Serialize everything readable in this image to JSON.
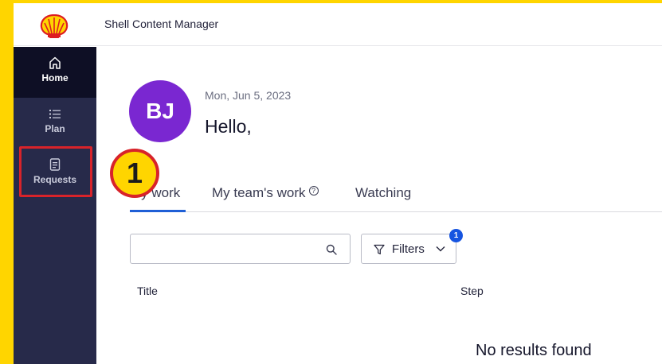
{
  "app": {
    "title": "Shell Content Manager",
    "logo_icon": "shell-logo-icon",
    "colors": {
      "frame": "#FFD500",
      "sidebar": "#272A4A",
      "sidebar_active": "#0E0F25",
      "accent": "#1F5FD6",
      "avatar": "#7A27D1",
      "highlight": "#D8232A"
    }
  },
  "sidebar": {
    "items": [
      {
        "label": "Home",
        "icon": "home-icon",
        "active": true
      },
      {
        "label": "Plan",
        "icon": "list-icon",
        "active": false
      },
      {
        "label": "Requests",
        "icon": "document-icon",
        "active": false
      }
    ]
  },
  "annotation": {
    "step_number": "1"
  },
  "user": {
    "initials": "BJ",
    "date": "Mon, Jun 5, 2023",
    "greeting": "Hello,"
  },
  "tabs": [
    {
      "label": "My work",
      "active": true
    },
    {
      "label": "My team's work",
      "active": false,
      "help_icon": "help-circle-icon",
      "help_glyph": "?"
    },
    {
      "label": "Watching",
      "active": false
    }
  ],
  "search": {
    "value": "",
    "placeholder": "",
    "icon": "search-icon"
  },
  "filters": {
    "label": "Filters",
    "count": "1",
    "icon": "funnel-icon"
  },
  "table": {
    "columns": [
      "Title",
      "Step"
    ],
    "empty_message": "No results found"
  }
}
